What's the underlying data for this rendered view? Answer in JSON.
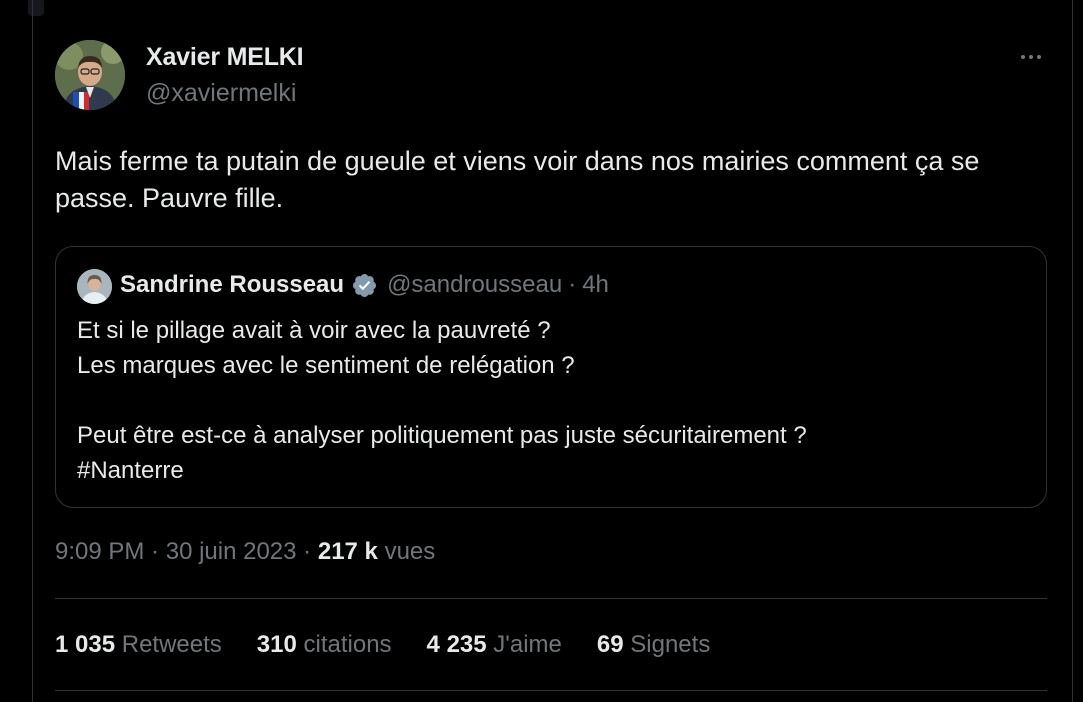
{
  "tweet": {
    "author_name": "Xavier MELKI",
    "author_handle": "@xaviermelki",
    "text": "Mais ferme ta putain de gueule et viens voir dans nos mairies comment ça se passe. Pauvre fille.",
    "time": "9:09 PM",
    "date": "30 juin 2023",
    "views_count": "217 k",
    "views_label": "vues",
    "separator": "·"
  },
  "quote": {
    "author_name": "Sandrine Rousseau",
    "author_handle": "@sandrousseau",
    "age": "4h",
    "separator": "·",
    "lines": [
      "Et si le pillage avait à voir avec la pauvreté ?",
      "Les marques avec le sentiment de relégation ?",
      "",
      "Peut être est-ce à analyser politiquement pas juste sécuritairement ?",
      "#Nanterre"
    ]
  },
  "stats": [
    {
      "count": "1 035",
      "label": "Retweets"
    },
    {
      "count": "310",
      "label": "citations"
    },
    {
      "count": "4 235",
      "label": "J'aime"
    },
    {
      "count": "69",
      "label": "Signets"
    }
  ],
  "icons": {
    "more": "more-horizontal-icon",
    "verified": "verified-badge-icon"
  },
  "colors": {
    "background": "#000000",
    "text": "#e7e9ea",
    "muted": "#71767b",
    "border": "#2f3336",
    "verified_badge": "#829aab"
  }
}
